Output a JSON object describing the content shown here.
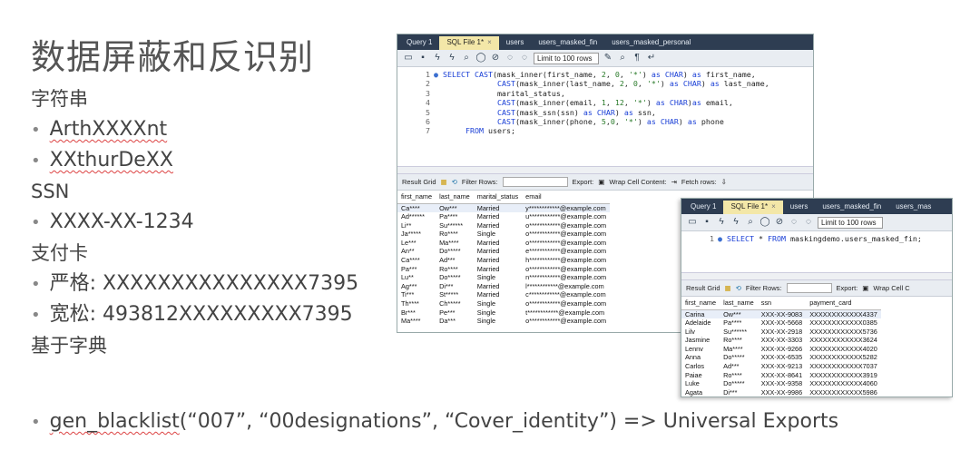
{
  "slide": {
    "title": "数据屏蔽和反识别",
    "lines": [
      {
        "text": "字符串",
        "kind": "heading"
      },
      {
        "text": "ArthXXXXnt",
        "kind": "bullet",
        "squiggle": true
      },
      {
        "text": "XXthurDeXX",
        "kind": "bullet",
        "squiggle": true
      },
      {
        "text": "SSN",
        "kind": "heading"
      },
      {
        "text": "XXXX-XX-1234",
        "kind": "bullet"
      },
      {
        "text": "支付卡",
        "kind": "heading"
      },
      {
        "text": "严格: XXXXXXXXXXXXXXX7395",
        "kind": "bullet"
      },
      {
        "text": "宽松: 493812XXXXXXXXX7395",
        "kind": "bullet"
      },
      {
        "text": "基于字典",
        "kind": "heading"
      }
    ],
    "bottom_prefix": "gen_blacklist",
    "bottom_rest": "(“007”, “00designations”, “Cover_identity”) => Universal Exports"
  },
  "window1": {
    "tabs": [
      "Query 1",
      "SQL File 1*",
      "users",
      "users_masked_fin",
      "users_masked_personal"
    ],
    "active_tab": 1,
    "limit": "Limit to 100 rows",
    "code_lines": [
      "SELECT CAST(mask_inner(first_name, 2, 0, '*') as CHAR) as first_name,",
      "            CAST(mask_inner(last_name, 2, 0, '*') as CHAR) as last_name,",
      "            marital_status,",
      "            CAST(mask_inner(email, 1, 12, '*') as CHAR)as email,",
      "            CAST(mask_ssn(ssn) as CHAR) as ssn,",
      "            CAST(mask_inner(phone, 5,0, '*') as CHAR) as phone",
      "     FROM users;"
    ],
    "result_bar": {
      "grid": "Result Grid",
      "filter": "Filter Rows:",
      "export": "Export:",
      "wrap": "Wrap Cell Content:",
      "fetch": "Fetch rows:"
    },
    "columns": [
      "first_name",
      "last_name",
      "marital_status",
      "email"
    ],
    "rows": [
      [
        "Ca****",
        "Ow***",
        "Married",
        "y************@example.com"
      ],
      [
        "Ad******",
        "Pa****",
        "Married",
        "u************@example.com"
      ],
      [
        "Li**",
        "Su******",
        "Married",
        "o************@example.com"
      ],
      [
        "Ja*****",
        "Ro****",
        "Single",
        "o************@example.com"
      ],
      [
        "Le***",
        "Ma****",
        "Married",
        "o************@example.com"
      ],
      [
        "An**",
        "Do*****",
        "Married",
        "e************@example.com"
      ],
      [
        "Ca****",
        "Ad***",
        "Married",
        "h************@example.com"
      ],
      [
        "Pa***",
        "Ro****",
        "Married",
        "o************@example.com"
      ],
      [
        "Lu**",
        "Do*****",
        "Single",
        "n************@example.com"
      ],
      [
        "Ag***",
        "Di***",
        "Married",
        "l************@example.com"
      ],
      [
        "Ti***",
        "St*****",
        "Married",
        "c************@example.com"
      ],
      [
        "Th****",
        "Ch*****",
        "Single",
        "o************@example.com"
      ],
      [
        "Br***",
        "Pe***",
        "Single",
        "t************@example.com"
      ],
      [
        "Ma****",
        "Da***",
        "Single",
        "o************@example.com"
      ]
    ]
  },
  "window2": {
    "tabs": [
      "Query 1",
      "SQL File 1*",
      "users",
      "users_masked_fin",
      "users_mas"
    ],
    "active_tab": 1,
    "limit": "Limit to 100 rows",
    "code_lines": [
      "SELECT * FROM maskingdemo.users_masked_fin;"
    ],
    "result_bar": {
      "grid": "Result Grid",
      "filter": "Filter Rows:",
      "export": "Export:",
      "wrap": "Wrap Cell C"
    },
    "columns": [
      "first_name",
      "last_name",
      "ssn",
      "payment_card"
    ],
    "rows": [
      [
        "Carina",
        "Ow***",
        "XXX-XX-9083",
        "XXXXXXXXXXXX4337"
      ],
      [
        "Adelaide",
        "Pa****",
        "XXX-XX-5668",
        "XXXXXXXXXXXX0385"
      ],
      [
        "Lilv",
        "Su******",
        "XXX-XX-2918",
        "XXXXXXXXXXXX5736"
      ],
      [
        "Jasmine",
        "Ro****",
        "XXX-XX-3303",
        "XXXXXXXXXXXX3624"
      ],
      [
        "Lennv",
        "Ma****",
        "XXX-XX-9266",
        "XXXXXXXXXXXX4020"
      ],
      [
        "Anna",
        "Do*****",
        "XXX-XX-6535",
        "XXXXXXXXXXXX5282"
      ],
      [
        "Carlos",
        "Ad***",
        "XXX-XX-9213",
        "XXXXXXXXXXXX7037"
      ],
      [
        "Paiae",
        "Ro****",
        "XXX-XX-8641",
        "XXXXXXXXXXXX3919"
      ],
      [
        "Luke",
        "Do*****",
        "XXX-XX-9358",
        "XXXXXXXXXXXX4060"
      ],
      [
        "Agata",
        "Di***",
        "XXX-XX-9986",
        "XXXXXXXXXXXX5986"
      ]
    ]
  }
}
